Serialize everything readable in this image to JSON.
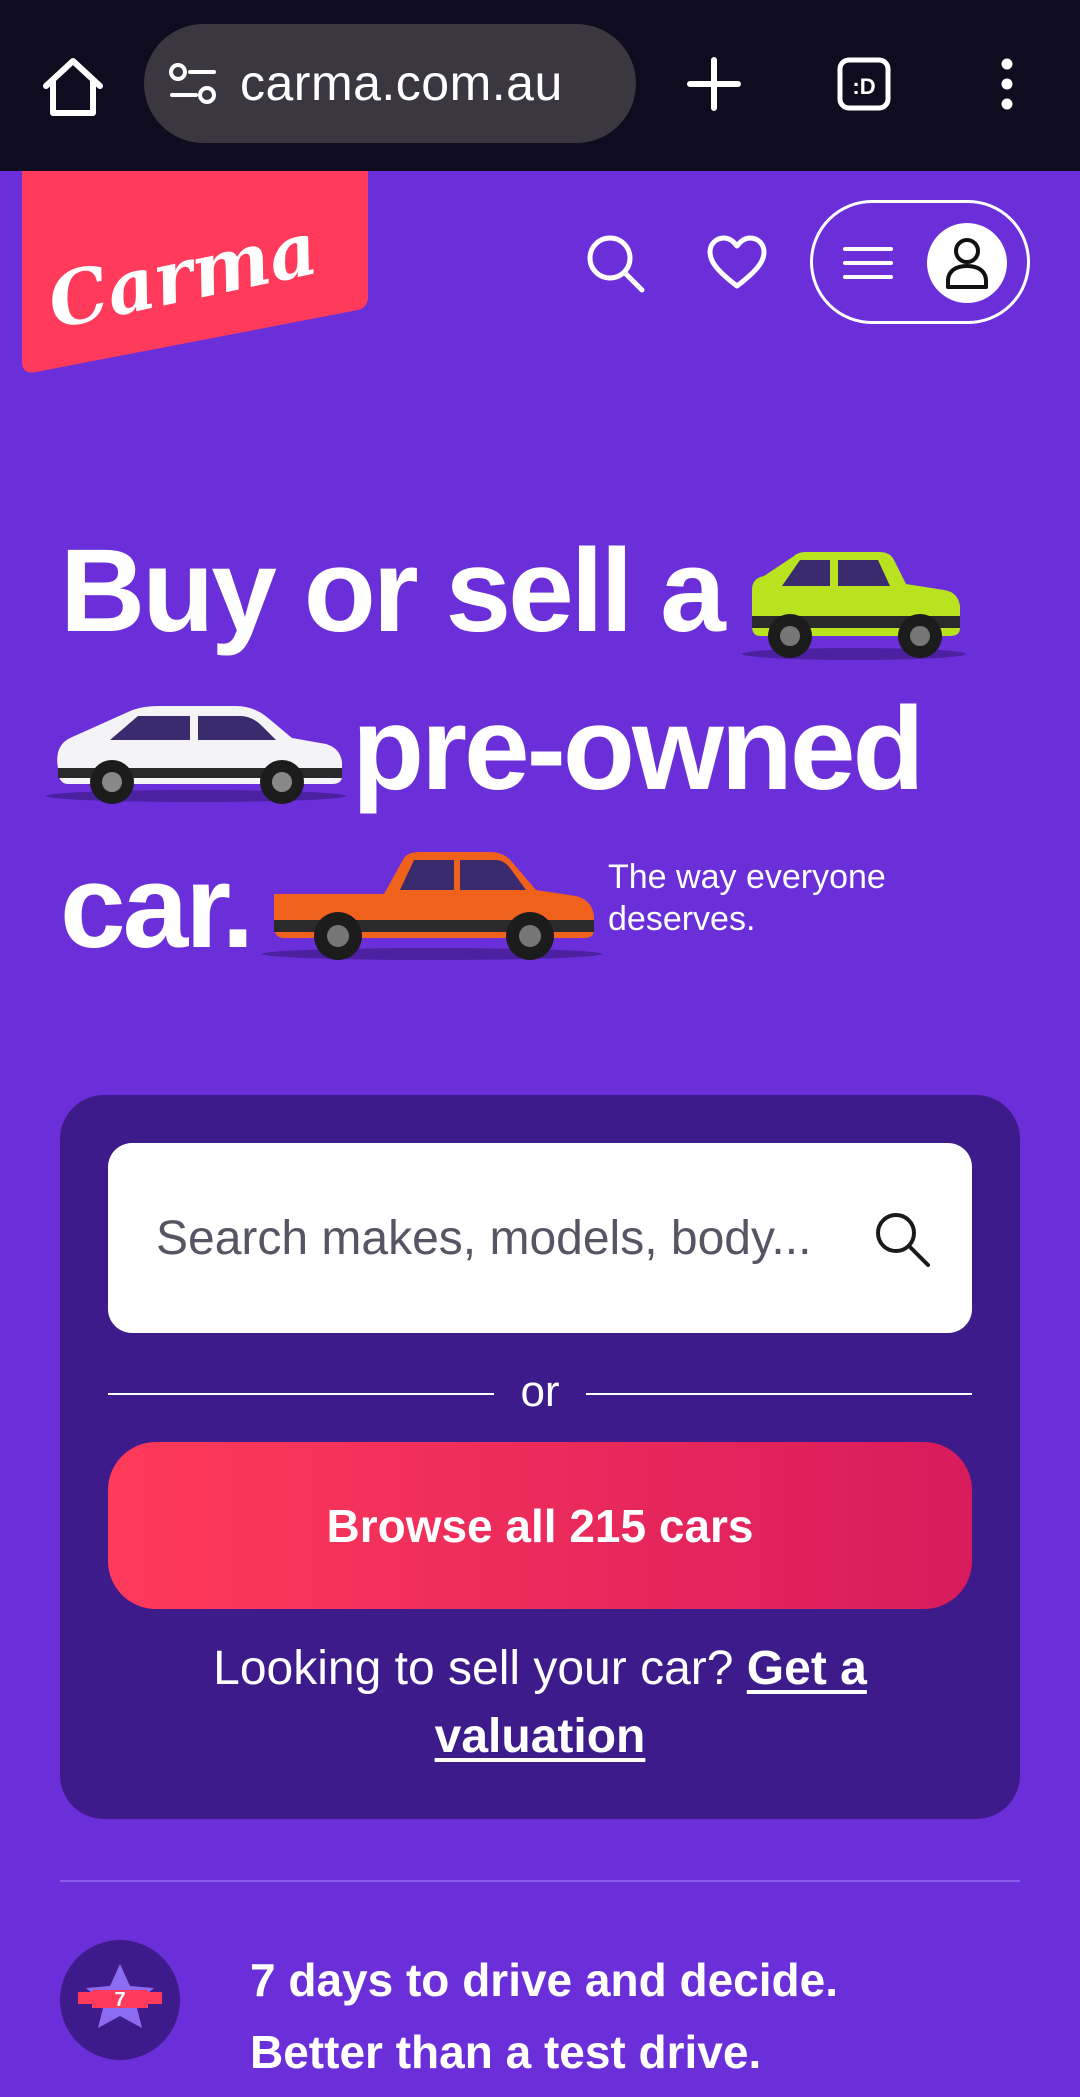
{
  "browser": {
    "url": "carma.com.au",
    "tab_count_glyph": ":D"
  },
  "header": {
    "logo_text": "Carma",
    "logo_color": "#ff3a5a"
  },
  "hero": {
    "line1": "Buy or sell a",
    "line2": "pre-owned",
    "line3": "car.",
    "tagline": "The way everyone deserves."
  },
  "search": {
    "placeholder": "Search makes, models, body...",
    "or_label": "or",
    "browse_label": "Browse all 215 cars",
    "sell_prompt": "Looking to sell your car?",
    "sell_link": "Get a valuation"
  },
  "promo": {
    "badge_number": "7",
    "line1": "7 days to drive and decide.",
    "line2": "Better than a test drive."
  },
  "colors": {
    "background": "#6a2fd9",
    "card": "#3e1b8a",
    "accent": "#ff3a5a"
  }
}
